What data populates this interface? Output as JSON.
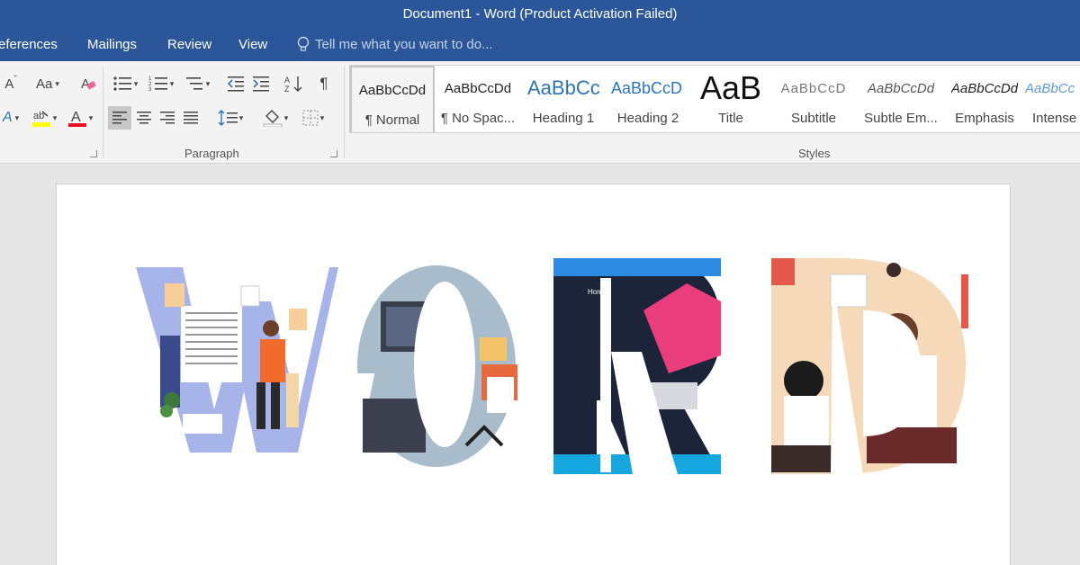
{
  "window": {
    "title": "Document1 - Word (Product Activation Failed)"
  },
  "tabs": [
    "eferences",
    "Mailings",
    "Review",
    "View"
  ],
  "tell_me": {
    "placeholder": "Tell me what you want to do..."
  },
  "ribbon": {
    "font_controls": {
      "shrink": "A",
      "case": "Aa"
    },
    "paragraph_label": "Paragraph",
    "styles_label": "Styles"
  },
  "styles": [
    {
      "sample": "AaBbCcDd",
      "name": "¶ Normal",
      "selected": true
    },
    {
      "sample": "AaBbCcDd",
      "name": "¶ No Spac..."
    },
    {
      "sample": "AaBbCc",
      "name": "Heading 1"
    },
    {
      "sample": "AaBbCcD",
      "name": "Heading 2"
    },
    {
      "sample": "AaB",
      "name": "Title"
    },
    {
      "sample": "AaBbCcD",
      "name": "Subtitle"
    },
    {
      "sample": "AaBbCcDd",
      "name": "Subtle Em..."
    },
    {
      "sample": "AaBbCcDd",
      "name": "Emphasis"
    },
    {
      "sample": "AaBbCc",
      "name": "Intense"
    }
  ],
  "colors": {
    "title_bar": "#2b579a",
    "ribbon_bg": "#f3f3f3",
    "heading_blue": "#2e74b5",
    "highlight_yellow": "#ffff00",
    "font_color_red": "#e81123"
  },
  "document": {
    "art_letters": [
      "W",
      "O",
      "R",
      "D"
    ]
  }
}
